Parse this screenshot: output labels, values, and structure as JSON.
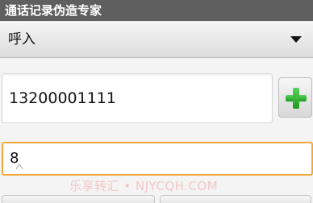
{
  "app": {
    "title": "通话记录伪造专家"
  },
  "call_type_spinner": {
    "selected_value": "呼入"
  },
  "phone_number_field": {
    "value": "13200001111"
  },
  "count_field": {
    "value": "8"
  },
  "watermark": {
    "text": "乐享转汇 • NJYCQH.COM"
  },
  "icons": {
    "add": "plus-icon",
    "dropdown": "triangle-down-icon"
  },
  "colors": {
    "title_bar": "#5f5f5f",
    "focus_border": "#f0a83c",
    "plus_green": "#2ea82e"
  }
}
